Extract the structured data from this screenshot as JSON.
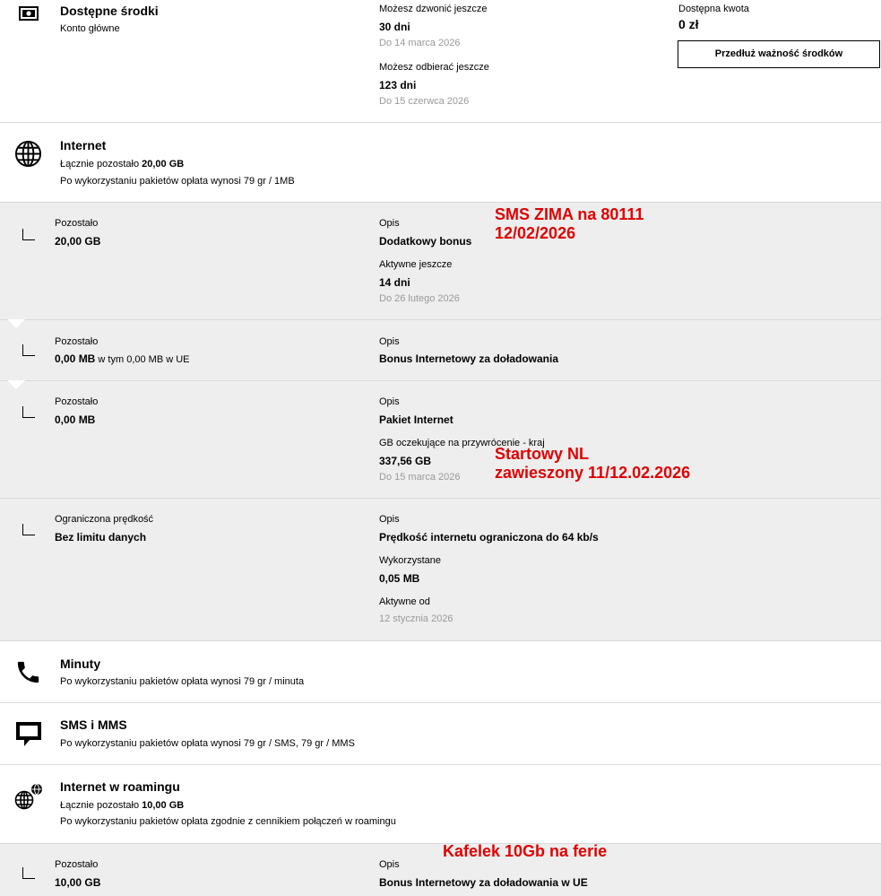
{
  "funds": {
    "title": "Dostępne środki",
    "subtitle": "Konto główne",
    "call_label": "Możesz dzwonić jeszcze",
    "call_value": "30 dni",
    "call_date": "Do 14 marca 2026",
    "receive_label": "Możesz odbierać jeszcze",
    "receive_value": "123 dni",
    "receive_date": "Do 15 czerwca 2026",
    "amount_label": "Dostępna kwota",
    "amount_value": "0 zł",
    "extend_button": "Przedłuż ważność środków"
  },
  "internet": {
    "title": "Internet",
    "total_prefix": "Łącznie pozostało",
    "total_value": "20,00 GB",
    "fee": "Po wykorzystaniu pakietów opłata wynosi 79 gr / 1MB"
  },
  "packages": [
    {
      "left_label": "Pozostało",
      "left_value": "20,00 GB",
      "desc_label": "Opis",
      "desc_value": "Dodatkowy bonus",
      "extra_label": "Aktywne jeszcze",
      "extra_value": "14 dni",
      "extra_date": "Do 26 lutego 2026"
    },
    {
      "left_label": "Pozostało",
      "left_value": "0,00 MB",
      "left_suffix": "w tym 0,00 MB w UE",
      "desc_label": "Opis",
      "desc_value": "Bonus Internetowy za doładowania"
    },
    {
      "left_label": "Pozostało",
      "left_value": "0,00 MB",
      "desc_label": "Opis",
      "desc_value": "Pakiet Internet",
      "extra_label": "GB oczekujące na przywrócenie - kraj",
      "extra_value": "337,56 GB",
      "extra_date": "Do 15 marca 2026"
    },
    {
      "left_label": "Ograniczona prędkość",
      "left_value": "Bez limitu danych",
      "desc_label": "Opis",
      "desc_value": "Prędkość internetu ograniczona do 64 kb/s",
      "used_label": "Wykorzystane",
      "used_value": "0,05 MB",
      "active_label": "Aktywne od",
      "active_date": "12 stycznia 2026"
    }
  ],
  "minutes": {
    "title": "Minuty",
    "fee": "Po wykorzystaniu pakietów opłata wynosi 79 gr / minuta"
  },
  "sms": {
    "title": "SMS i MMS",
    "fee": "Po wykorzystaniu pakietów opłata wynosi 79 gr / SMS, 79 gr / MMS"
  },
  "roaming": {
    "title": "Internet w roamingu",
    "total_prefix": "Łącznie pozostało",
    "total_value": "10,00 GB",
    "fee": "Po wykorzystaniu pakietów opłata zgodnie z cennikiem połączeń w roamingu",
    "package": {
      "left_label": "Pozostało",
      "left_value": "10,00 GB",
      "desc_label": "Opis",
      "desc_value": "Bonus Internetowy za doładowania w UE"
    }
  },
  "annotations": {
    "a1_line1": "SMS ZIMA na 80111",
    "a1_line2": "12/02/2026",
    "a2_line1": "Startowy NL",
    "a2_line2": "zawieszony 11/12.02.2026",
    "a3": "Kafelek 10Gb na ferie"
  },
  "colors": {
    "annotation": "#e00000",
    "panel_grey": "#eeeeee",
    "divider": "#d9d9d9",
    "secondary_text": "#999999"
  }
}
